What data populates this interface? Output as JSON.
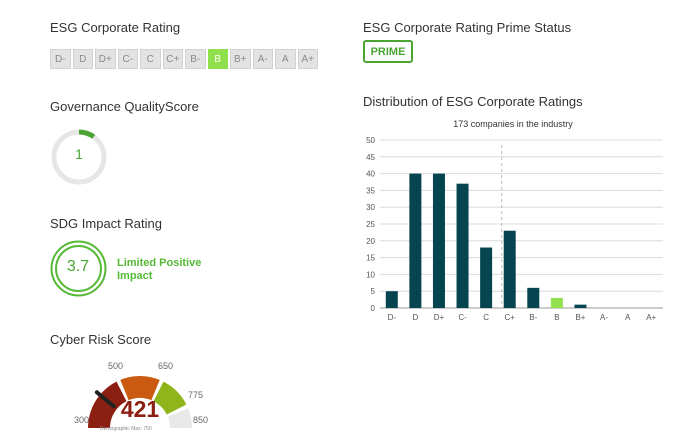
{
  "esg_rating": {
    "title": "ESG Corporate Rating",
    "grades": [
      "D-",
      "D",
      "D+",
      "C-",
      "C",
      "C+",
      "B-",
      "B",
      "B+",
      "A-",
      "A",
      "A+"
    ],
    "selected": "B"
  },
  "prime_status": {
    "title": "ESG Corporate Rating Prime Status",
    "label": "PRIME"
  },
  "governance": {
    "title": "Governance QualityScore",
    "value": "1",
    "fraction": 0.1
  },
  "sdg": {
    "title": "SDG Impact Rating",
    "value": "3.7",
    "label": "Limited Positive Impact"
  },
  "cyber": {
    "title": "Cyber Risk Score",
    "score": "421",
    "ticks": [
      "300",
      "500",
      "650",
      "775",
      "850"
    ],
    "subtitle": "Demographic Max: 750",
    "colors": [
      "#8b2012",
      "#c95a10",
      "#8fb51a",
      "#e8e8e8"
    ]
  },
  "distribution": {
    "title": "Distribution of ESG Corporate Ratings",
    "subtitle": "173 companies in the industry"
  },
  "chart_data": {
    "type": "bar",
    "categories": [
      "D-",
      "D",
      "D+",
      "C-",
      "C",
      "C+",
      "B-",
      "B",
      "B+",
      "A-",
      "A",
      "A+"
    ],
    "values": [
      5,
      40,
      40,
      37,
      18,
      23,
      6,
      3,
      1,
      0,
      0,
      0
    ],
    "highlight": "B",
    "bar_color": "#06454f",
    "highlight_color": "#93e04e",
    "ylim": [
      0,
      50
    ],
    "yticks": [
      0,
      5,
      10,
      15,
      20,
      25,
      30,
      35,
      40,
      45,
      50
    ],
    "marker_category": "C+",
    "grid": true
  }
}
